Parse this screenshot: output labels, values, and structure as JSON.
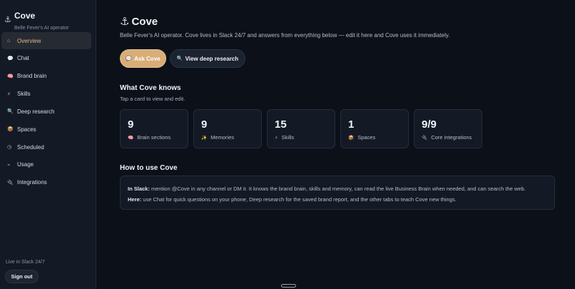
{
  "sidebar": {
    "brand_icon": "anchor-icon",
    "brand_title": "Cove",
    "brand_subtitle": "Belle Fever's AI operator",
    "items": [
      {
        "label": "Overview",
        "icon": "home-icon",
        "glyph": "⌂",
        "active": true
      },
      {
        "label": "Chat",
        "icon": "speech-bubble-icon",
        "glyph": "💬",
        "active": false
      },
      {
        "label": "Brand brain",
        "icon": "brain-icon",
        "glyph": "🧠",
        "active": false
      },
      {
        "label": "Skills",
        "icon": "lightning-icon",
        "glyph": "⚡",
        "active": false
      },
      {
        "label": "Deep research",
        "icon": "magnifier-icon",
        "glyph": "🔍",
        "active": false
      },
      {
        "label": "Spaces",
        "icon": "package-icon",
        "glyph": "📦",
        "active": false
      },
      {
        "label": "Scheduled",
        "icon": "clock-icon",
        "glyph": "◷",
        "active": false
      },
      {
        "label": "Usage",
        "icon": "chart-icon",
        "glyph": "⌁",
        "active": false
      },
      {
        "label": "Integrations",
        "icon": "plug-icon",
        "glyph": "🔌",
        "active": false
      }
    ],
    "status_text": "Live in Slack 24/7",
    "signout_label": "Sign out"
  },
  "main": {
    "title_icon": "anchor-icon",
    "title": "Cove",
    "subtitle": "Belle Fever's AI operator. Cove lives in Slack 24/7 and answers from everything below — edit it here and Cove uses it immediately.",
    "buttons": {
      "ask_label": "Ask Cove",
      "ask_icon": "speech-bubble-icon",
      "research_label": "View deep research",
      "research_icon": "magnifier-icon"
    },
    "knows": {
      "title": "What Cove knows",
      "subtitle": "Tap a card to view and edit.",
      "cards": [
        {
          "value": "9",
          "label": "Brain sections",
          "icon": "brain-icon",
          "glyph": "🧠"
        },
        {
          "value": "9",
          "label": "Memories",
          "icon": "sparkles-icon",
          "glyph": "✨"
        },
        {
          "value": "15",
          "label": "Skills",
          "icon": "lightning-icon",
          "glyph": "⚡"
        },
        {
          "value": "1",
          "label": "Spaces",
          "icon": "package-icon",
          "glyph": "📦"
        },
        {
          "value": "9/9",
          "label": "Core integrations",
          "icon": "plug-icon",
          "glyph": "🔌"
        }
      ]
    },
    "howto": {
      "title": "How to use Cove",
      "slack_label": "In Slack:",
      "slack_text": " mention @Cove in any channel or DM it. It knows the brand brain, skills and memory, can read the live Business Brain when needed, and can search the web.",
      "here_label": "Here:",
      "here_text": " use Chat for quick questions on your phone, Deep research for the saved brand report, and the other tabs to teach Cove new things."
    }
  },
  "colors": {
    "accent": "#d8ad78",
    "background": "#0c1019",
    "sidebar": "#131a26",
    "active_text": "#e3b982"
  }
}
